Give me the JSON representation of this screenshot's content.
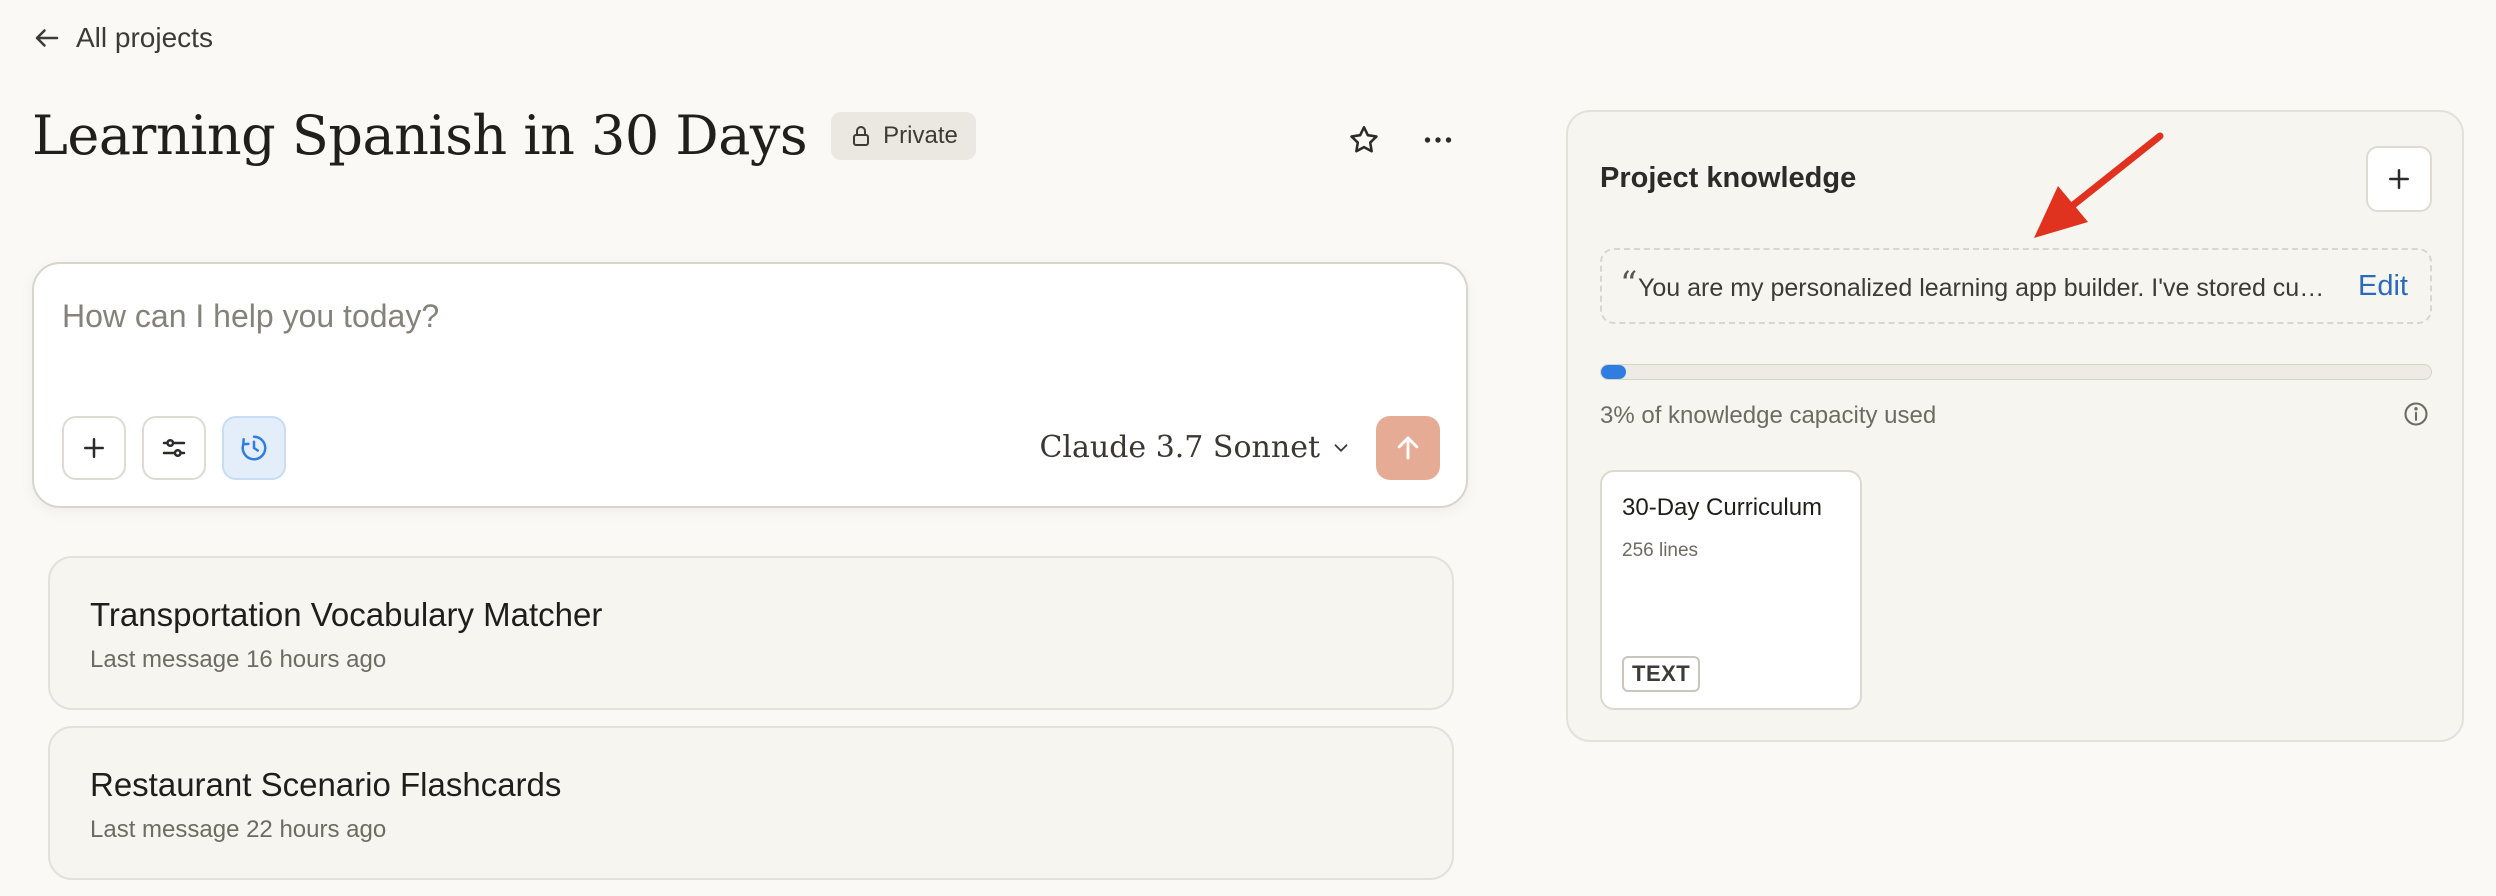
{
  "nav": {
    "back_label": "All projects"
  },
  "project": {
    "title": "Learning Spanish in 30 Days",
    "visibility_label": "Private"
  },
  "composer": {
    "placeholder": "How can I help you today?",
    "model_label": "Claude 3.7 Sonnet"
  },
  "conversations": [
    {
      "title": "Transportation Vocabulary Matcher",
      "subtitle": "Last message 16 hours ago"
    },
    {
      "title": "Restaurant Scenario Flashcards",
      "subtitle": "Last message 22 hours ago"
    }
  ],
  "knowledge": {
    "title": "Project knowledge",
    "quote_mark": "“",
    "instructions_text": "You are my personalized learning app builder. I've stored curri...",
    "edit_label": "Edit",
    "capacity_used_fraction": 0.03,
    "capacity_text": "3% of knowledge capacity used",
    "files": [
      {
        "name": "30-Day Curriculum",
        "meta": "256 lines",
        "type": "TEXT"
      }
    ]
  },
  "colors": {
    "accent_blue": "#2f7de0",
    "send_button": "#e6ab95",
    "edit_link": "#2a6bbf",
    "annotation_arrow": "#e0321f"
  },
  "icons": {
    "back": "arrow-left-icon",
    "lock": "lock-icon",
    "star": "star-icon",
    "more": "more-horizontal-icon",
    "add": "plus-icon",
    "settings": "sliders-icon",
    "history": "clock-icon",
    "chevron": "chevron-down-icon",
    "send": "arrow-up-icon",
    "info": "info-icon"
  }
}
